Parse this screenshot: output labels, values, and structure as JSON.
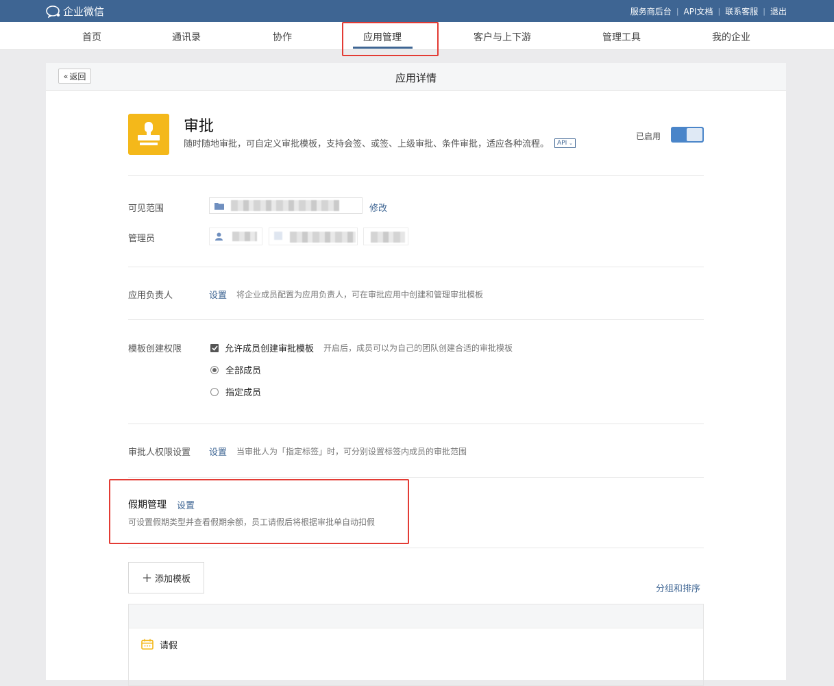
{
  "topbar": {
    "brand": "企业微信",
    "links": [
      "服务商后台",
      "API文档",
      "联系客服",
      "退出"
    ]
  },
  "nav": {
    "items": [
      "首页",
      "通讯录",
      "协作",
      "应用管理",
      "客户与上下游",
      "管理工具",
      "我的企业"
    ],
    "active": "应用管理"
  },
  "page": {
    "back_label": "返回",
    "title": "应用详情"
  },
  "app": {
    "name": "审批",
    "description": "随时随地审批，可自定义审批模板，支持会签、或签、上级审批、条件审批，适应各种流程。",
    "api_tag": "API",
    "status": "已启用",
    "enabled": true
  },
  "visibility": {
    "label": "可见范围",
    "edit_link": "修改"
  },
  "admins": {
    "label": "管理员"
  },
  "owner": {
    "label": "应用负责人",
    "action": "设置",
    "hint": "将企业成员配置为应用负责人，可在审批应用中创建和管理审批模板"
  },
  "template_permission": {
    "label": "模板创建权限",
    "checkbox_label": "允许成员创建审批模板",
    "checkbox_checked": true,
    "checkbox_hint": "开启后，成员可以为自己的团队创建合适的审批模板",
    "options": [
      "全部成员",
      "指定成员"
    ],
    "selected_option": "全部成员"
  },
  "approver_permission": {
    "label": "审批人权限设置",
    "action": "设置",
    "hint": "当审批人为「指定标签」时，可分别设置标签内成员的审批范围"
  },
  "holiday": {
    "title": "假期管理",
    "action": "设置",
    "hint": "可设置假期类型并查看假期余额，员工请假后将根据审批单自动扣假"
  },
  "templates": {
    "add_label": "添加模板",
    "sort_link": "分组和排序",
    "items": [
      "请假"
    ]
  },
  "colors": {
    "topbar": "#3e6593",
    "link": "#3e6593",
    "app_icon": "#f4b81a",
    "toggle": "#4a85c9",
    "highlight": "#e33b34"
  }
}
